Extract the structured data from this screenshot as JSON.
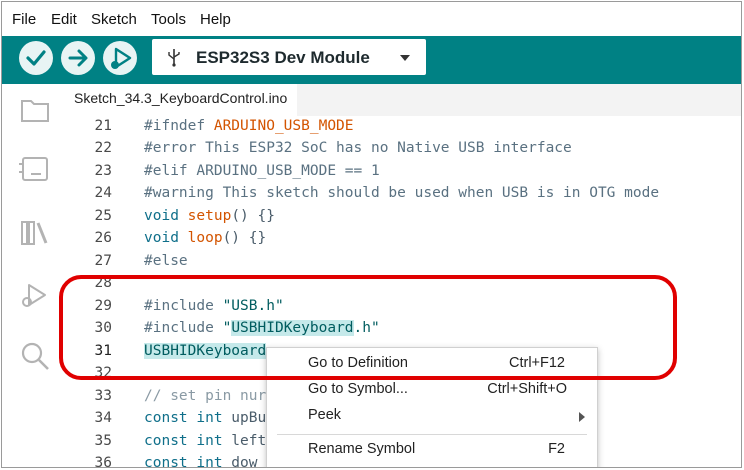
{
  "menubar": {
    "items": [
      "File",
      "Edit",
      "Sketch",
      "Tools",
      "Help"
    ]
  },
  "toolbar": {
    "buttons": [
      {
        "icon": "check-icon",
        "label": "verify"
      },
      {
        "icon": "arrow-right-icon",
        "label": "upload"
      },
      {
        "icon": "debug-icon",
        "label": "debug"
      }
    ],
    "board": "ESP32S3 Dev Module",
    "accent": "#008184"
  },
  "sidebar": {
    "icons": [
      "folder-icon",
      "board-manager-icon",
      "library-icon",
      "debug-icon",
      "search-icon"
    ]
  },
  "tabs": [
    {
      "label": "Sketch_34.3_KeyboardControl.ino"
    }
  ],
  "editor": {
    "lines": [
      {
        "n": "21",
        "text": "#ifndef ARDUINO_USB_MODE"
      },
      {
        "n": "22",
        "text": "#error This ESP32 SoC has no Native USB interface"
      },
      {
        "n": "23",
        "text": "#elif ARDUINO_USB_MODE == 1"
      },
      {
        "n": "24",
        "text": "#warning This sketch should be used when USB is in OTG mode"
      },
      {
        "n": "25",
        "text": "void setup() {}"
      },
      {
        "n": "26",
        "text": "void loop() {}"
      },
      {
        "n": "27",
        "text": "#else"
      },
      {
        "n": "28",
        "text": ""
      },
      {
        "n": "29",
        "text": "#include \"USB.h\""
      },
      {
        "n": "30",
        "text": "#include \"USBHIDKeyboard.h\""
      },
      {
        "n": "31",
        "text": "USBHIDKeyboard"
      },
      {
        "n": "32",
        "text": ""
      },
      {
        "n": "33",
        "text": "// set pin nur"
      },
      {
        "n": "34",
        "text": "const int upBu"
      },
      {
        "n": "35",
        "text": "const int left"
      },
      {
        "n": "36",
        "text": "const int dow"
      }
    ]
  },
  "context_menu": {
    "items": [
      {
        "label": "Go to Definition",
        "shortcut": "Ctrl+F12"
      },
      {
        "label": "Go to Symbol...",
        "shortcut": "Ctrl+Shift+O"
      },
      {
        "label": "Peek",
        "shortcut": ""
      },
      {
        "label": "Rename Symbol",
        "shortcut": "F2"
      }
    ]
  },
  "highlight_color": "#e00000"
}
